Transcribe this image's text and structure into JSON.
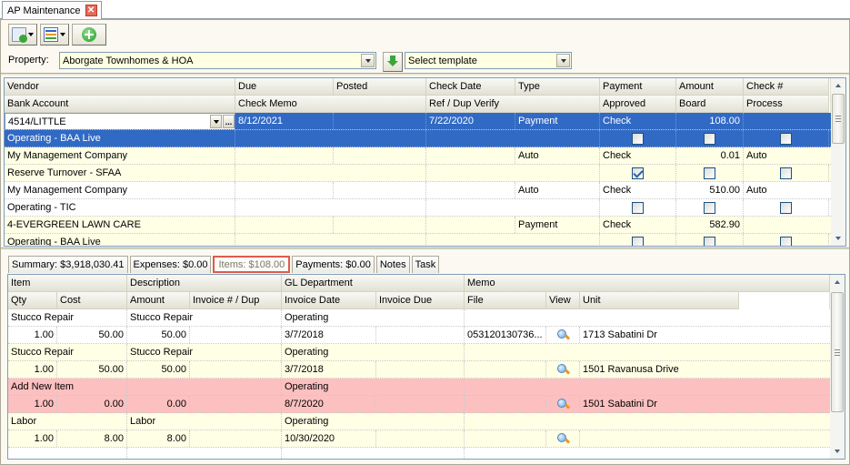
{
  "window": {
    "tab_title": "AP Maintenance"
  },
  "toolbar": {
    "buttons": [
      {
        "name": "document-approve",
        "icon": "document-check-icon",
        "has_dropdown": true
      },
      {
        "name": "layout",
        "icon": "layout-grid-icon",
        "has_dropdown": true
      },
      {
        "name": "add",
        "icon": "add-circle-icon",
        "has_dropdown": false
      }
    ]
  },
  "property": {
    "label": "Property:",
    "value": "Aborgate Townhomes & HOA",
    "template_placeholder": "Select template"
  },
  "top_grid": {
    "header_row1": [
      "Vendor",
      "Due",
      "Posted",
      "Check Date",
      "Type",
      "Payment",
      "Amount",
      "Check #"
    ],
    "header_row2": [
      "Bank Account",
      "Check Memo",
      "",
      "Ref / Dup Verify",
      "",
      "Approved",
      "Board",
      "Process"
    ],
    "records": [
      {
        "vendor": "4514/LITTLE",
        "due": "8/12/2021",
        "posted": "",
        "check_date": "7/22/2020",
        "type": "Payment",
        "payment": "Check",
        "amount": "108.00",
        "check_no": "",
        "bank_account": "Operating - BAA Live",
        "approved": false,
        "board": false,
        "process": false,
        "selected": true,
        "row_style": "selected"
      },
      {
        "vendor": "My Management Company",
        "due": "",
        "posted": "",
        "check_date": "",
        "type": "Auto",
        "payment": "Check",
        "amount": "0.01",
        "check_no": "Auto",
        "bank_account": "Reserve Turnover - SFAA",
        "approved": true,
        "board": false,
        "process": false,
        "selected": false,
        "row_style": "yellow"
      },
      {
        "vendor": "My Management Company",
        "due": "",
        "posted": "",
        "check_date": "",
        "type": "Auto",
        "payment": "Check",
        "amount": "510.00",
        "check_no": "Auto",
        "bank_account": "Operating - TIC",
        "approved": false,
        "board": false,
        "process": false,
        "selected": false,
        "row_style": "white"
      },
      {
        "vendor": "4-EVERGREEN LAWN CARE",
        "due": "",
        "posted": "",
        "check_date": "",
        "type": "Payment",
        "payment": "Check",
        "amount": "582.90",
        "check_no": "",
        "bank_account": "Operating - BAA Live",
        "approved": false,
        "board": false,
        "process": false,
        "selected": false,
        "row_style": "yellow"
      }
    ]
  },
  "bottom_tabs": [
    {
      "label": "Summary: $3,918,030.41",
      "active": false
    },
    {
      "label": "Expenses:  $0.00",
      "active": false
    },
    {
      "label": "Items:  $108.00",
      "active": true
    },
    {
      "label": "Payments: $0.00",
      "active": false
    },
    {
      "label": "Notes",
      "active": false
    },
    {
      "label": "Task",
      "active": false
    }
  ],
  "items_grid": {
    "header_row1": [
      "Item",
      "Description",
      "GL Department",
      "Memo"
    ],
    "header_row2": [
      "Qty",
      "Cost",
      "Amount",
      "Invoice # / Dup",
      "Invoice Date",
      "Invoice Due",
      "File",
      "View",
      "Unit"
    ],
    "records": [
      {
        "item": "Stucco Repair",
        "description": "Stucco Repair",
        "gl_department": "Operating",
        "memo": "",
        "qty": "1.00",
        "cost": "50.00",
        "amount": "50.00",
        "invoice_no": "",
        "invoice_date": "3/7/2018",
        "invoice_due": "",
        "file": "053120130736...",
        "view_icon": "magnifier-icon",
        "unit": "1713 Sabatini Dr",
        "row_style": "white"
      },
      {
        "item": "Stucco Repair",
        "description": "Stucco Repair",
        "gl_department": "Operating",
        "memo": "",
        "qty": "1.00",
        "cost": "50.00",
        "amount": "50.00",
        "invoice_no": "",
        "invoice_date": "3/7/2018",
        "invoice_due": "",
        "file": "",
        "view_icon": "magnifier-icon",
        "unit": "1501 Ravanusa Drive",
        "row_style": "yellow"
      },
      {
        "item": "Add New Item",
        "description": "",
        "gl_department": "Operating",
        "memo": "",
        "qty": "1.00",
        "cost": "0.00",
        "amount": "0.00",
        "invoice_no": "",
        "invoice_date": "8/7/2020",
        "invoice_due": "",
        "file": "",
        "view_icon": "magnifier-icon",
        "unit": "1501 Sabatini Dr",
        "row_style": "pink"
      },
      {
        "item": "Labor",
        "description": "Labor",
        "gl_department": "Operating",
        "memo": "",
        "qty": "1.00",
        "cost": "8.00",
        "amount": "8.00",
        "invoice_no": "",
        "invoice_date": "10/30/2020",
        "invoice_due": "",
        "file": "",
        "view_icon": "magnifier-icon",
        "unit": "",
        "row_style": "yellow"
      }
    ]
  },
  "colors": {
    "selection": "#316ac5",
    "row_yellow": "#ffffe6",
    "row_pink": "#fdc0c0",
    "active_tab_border": "#e05a4e"
  }
}
